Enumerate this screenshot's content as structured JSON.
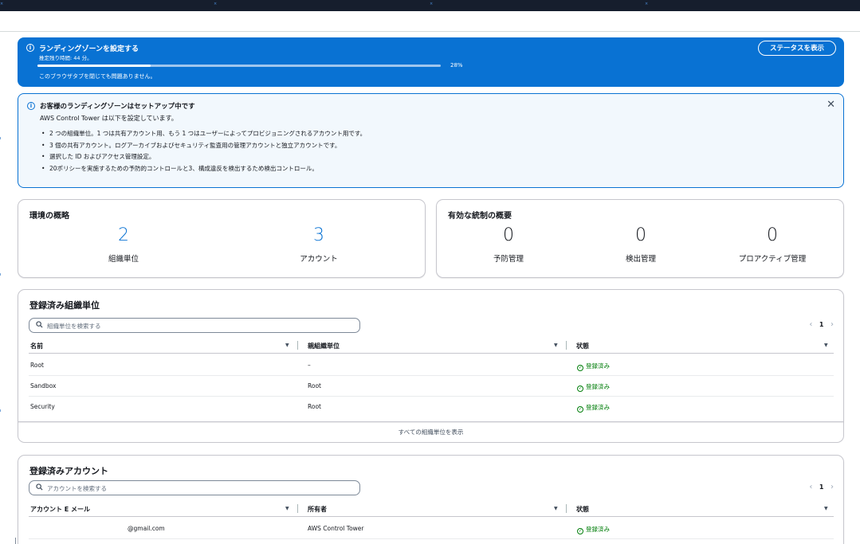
{
  "progress_banner": {
    "title": "ランディングゾーンを設定する",
    "remaining": "推定残り時間: 44 分。",
    "progress_percent": 28,
    "progress_label": "28%",
    "note": "このブラウザタブを閉じても問題ありません。",
    "status_button": "ステータスを表示"
  },
  "alert": {
    "title": "お客様のランディングゾーンはセットアップ中です",
    "lead": "AWS Control Tower は以下を設定しています。",
    "items": [
      "2 つの組織単位。1 つは共有アカウント用、もう 1 つはユーザーによってプロビジョニングされるアカウント用です。",
      "3 個の共有アカウント。ログアーカイブおよびセキュリティ監査用の管理アカウントと独立アカウントです。",
      "選択した ID およびアクセス管理設定。",
      "20ポリシーを実施するための予防的コントロールと3、構成違反を検出するため検出コントロール。"
    ],
    "close_icon": "close-icon"
  },
  "environment": {
    "title": "環境の概略",
    "metrics": [
      {
        "value": "2",
        "label": "組織単位"
      },
      {
        "value": "3",
        "label": "アカウント"
      }
    ]
  },
  "controls": {
    "title": "有効な統制の概要",
    "metrics": [
      {
        "value": "0",
        "label": "予防管理"
      },
      {
        "value": "0",
        "label": "検出管理"
      },
      {
        "value": "0",
        "label": "プロアクティブ管理"
      }
    ]
  },
  "ou_table": {
    "title": "登録済み組織単位",
    "search_placeholder": "組織単位を検索する",
    "page": "1",
    "columns": [
      "名前",
      "親組織単位",
      "状態"
    ],
    "rows": [
      {
        "name": "Root",
        "parent": "–",
        "status": "登録済み"
      },
      {
        "name": "Sandbox",
        "parent": "Root",
        "status": "登録済み"
      },
      {
        "name": "Security",
        "parent": "Root",
        "status": "登録済み"
      }
    ],
    "view_all": "すべての組織単位を表示"
  },
  "account_table": {
    "title": "登録済みアカウント",
    "search_placeholder": "アカウントを検索する",
    "page": "1",
    "columns": [
      "アカウント E メール",
      "所有者",
      "状態"
    ],
    "rows": [
      {
        "email": "@gmail.com",
        "owner": "AWS Control Tower",
        "status": "登録済み"
      }
    ]
  },
  "colors": {
    "accent": "#0972d3",
    "success": "#037f0c",
    "info_bg": "#f2f8fd"
  }
}
